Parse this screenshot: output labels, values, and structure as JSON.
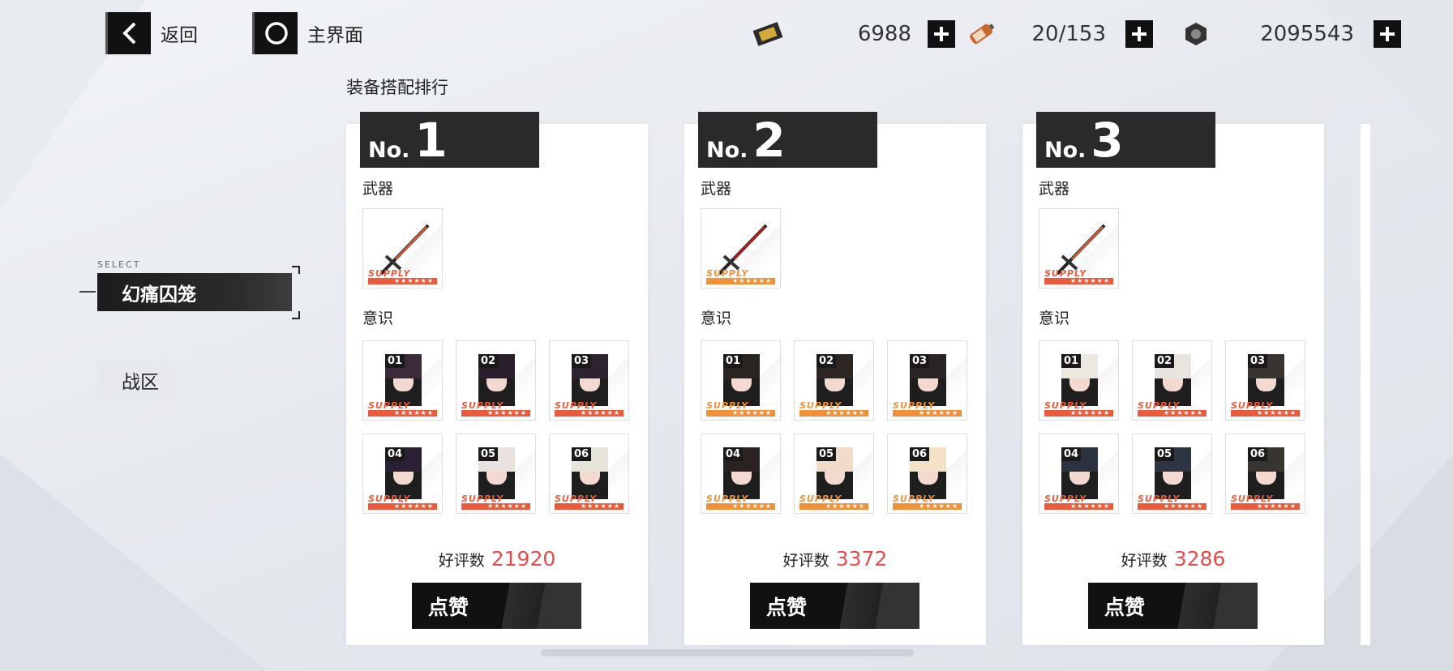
{
  "top": {
    "back_label": "返回",
    "home_label": "主界面"
  },
  "resources": [
    {
      "icon": "ticket-icon",
      "value": "6988"
    },
    {
      "icon": "battery-icon",
      "value": "20/153"
    },
    {
      "icon": "coin-icon",
      "value": "2095543"
    }
  ],
  "section_title": "装备搭配排行",
  "sidebar": {
    "select_tag": "SELECT",
    "items": [
      {
        "label": "幻痛囚笼",
        "active": true
      },
      {
        "label": "战区",
        "active": false
      }
    ]
  },
  "labels": {
    "no": "No.",
    "weapon": "武器",
    "memory": "意识",
    "likes": "好评数",
    "like_button": "点赞",
    "supply": "SUPPLY",
    "stars": "★★★★★★"
  },
  "cards": [
    {
      "rank": "1",
      "likes": "21920",
      "slots": [
        "01",
        "02",
        "03",
        "04",
        "05",
        "06"
      ]
    },
    {
      "rank": "2",
      "likes": "3372",
      "slots": [
        "01",
        "02",
        "03",
        "04",
        "05",
        "06"
      ]
    },
    {
      "rank": "3",
      "likes": "3286",
      "slots": [
        "01",
        "02",
        "03",
        "04",
        "05",
        "06"
      ]
    }
  ]
}
